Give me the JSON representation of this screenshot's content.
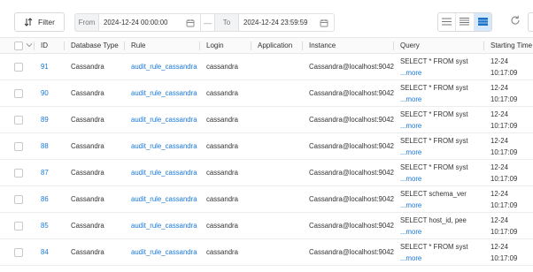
{
  "toolbar": {
    "filter_label": "Filter",
    "from_label": "From",
    "from_value": "2024-12-24 00:00:00",
    "separator": "—",
    "to_label": "To",
    "to_value": "2024-12-24 23:59:59"
  },
  "table": {
    "columns": [
      "ID",
      "Database Type",
      "Rule",
      "Login",
      "Application",
      "Instance",
      "Query",
      "Starting Time"
    ],
    "more_label": "...more",
    "rows": [
      {
        "id": "91",
        "db_type": "Cassandra",
        "rule": "audit_rule_cassandra",
        "login": "cassandra",
        "application": "",
        "instance": "Cassandra@localhost:9042",
        "query": "SELECT * FROM syst",
        "date": "12-24",
        "time": "10:17:09"
      },
      {
        "id": "90",
        "db_type": "Cassandra",
        "rule": "audit_rule_cassandra",
        "login": "cassandra",
        "application": "",
        "instance": "Cassandra@localhost:9042",
        "query": "SELECT * FROM syst",
        "date": "12-24",
        "time": "10:17:09"
      },
      {
        "id": "89",
        "db_type": "Cassandra",
        "rule": "audit_rule_cassandra",
        "login": "cassandra",
        "application": "",
        "instance": "Cassandra@localhost:9042",
        "query": "SELECT * FROM syst",
        "date": "12-24",
        "time": "10:17:09"
      },
      {
        "id": "88",
        "db_type": "Cassandra",
        "rule": "audit_rule_cassandra",
        "login": "cassandra",
        "application": "",
        "instance": "Cassandra@localhost:9042",
        "query": "SELECT * FROM syst",
        "date": "12-24",
        "time": "10:17:09"
      },
      {
        "id": "87",
        "db_type": "Cassandra",
        "rule": "audit_rule_cassandra",
        "login": "cassandra",
        "application": "",
        "instance": "Cassandra@localhost:9042",
        "query": "SELECT * FROM syst",
        "date": "12-24",
        "time": "10:17:09"
      },
      {
        "id": "86",
        "db_type": "Cassandra",
        "rule": "audit_rule_cassandra",
        "login": "cassandra",
        "application": "",
        "instance": "Cassandra@localhost:9042",
        "query": "SELECT schema_ver",
        "date": "12-24",
        "time": "10:17:09"
      },
      {
        "id": "85",
        "db_type": "Cassandra",
        "rule": "audit_rule_cassandra",
        "login": "cassandra",
        "application": "",
        "instance": "Cassandra@localhost:9042",
        "query": "SELECT host_id, pee",
        "date": "12-24",
        "time": "10:17:09"
      },
      {
        "id": "84",
        "db_type": "Cassandra",
        "rule": "audit_rule_cassandra",
        "login": "cassandra",
        "application": "",
        "instance": "Cassandra@localhost:9042",
        "query": "SELECT * FROM syst",
        "date": "12-24",
        "time": "10:17:09"
      }
    ]
  },
  "icons": {
    "filter": "sort-filter-icon",
    "calendar": "calendar-icon",
    "views": [
      "list-view-icon",
      "compact-view-icon",
      "grid-view-icon"
    ],
    "refresh": "refresh-icon"
  },
  "colors": {
    "link": "#1677d6",
    "active_view": "#d6e8fb"
  }
}
